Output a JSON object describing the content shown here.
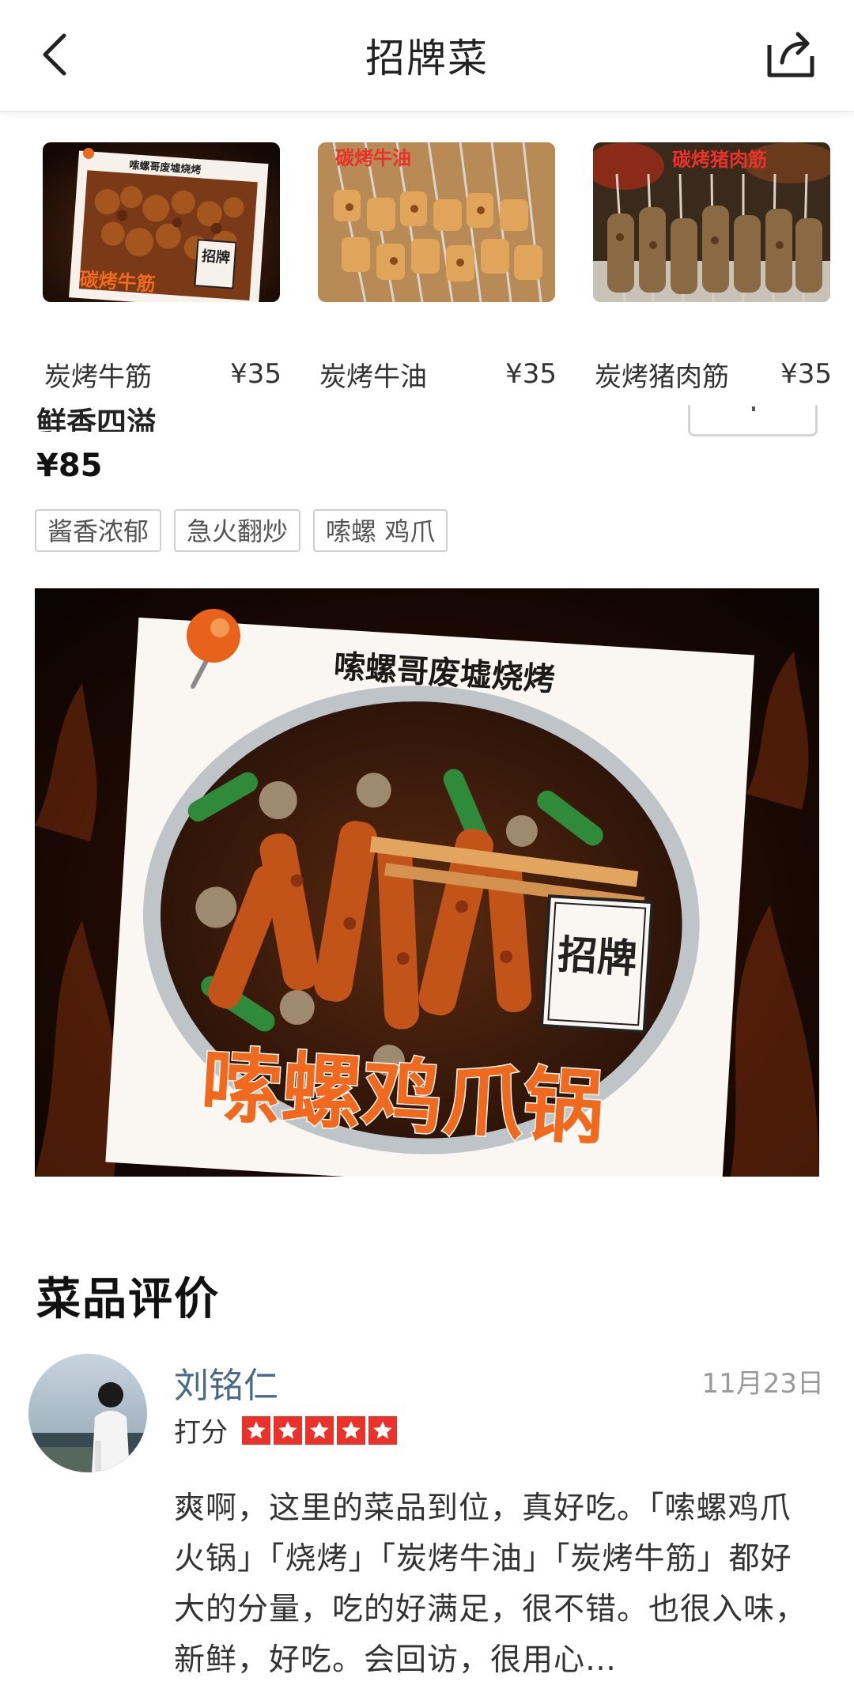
{
  "header": {
    "title": "招牌菜",
    "back_icon": "chevron-left-icon",
    "share_icon": "share-icon"
  },
  "carousel": {
    "items": [
      {
        "name": "炭烤牛筋",
        "price": "¥35",
        "image_caption": "碳烤牛筋"
      },
      {
        "name": "炭烤牛油",
        "price": "¥35",
        "image_caption": "碳烤牛油"
      },
      {
        "name": "炭烤猪肉筋",
        "price": "¥35",
        "image_caption": "碳烤猪肉筋"
      }
    ],
    "badge_text": "招牌",
    "shop_banner": "嗦螺哥废墟烧烤"
  },
  "dish": {
    "name_partial": "鲜香四溢",
    "price": "¥85",
    "tags": [
      "酱香浓郁",
      "急火翻炒",
      "嗦螺 鸡爪"
    ],
    "hero": {
      "banner": "嗦螺哥废墟烧烤",
      "badge": "招牌",
      "title": "嗦螺鸡爪锅"
    }
  },
  "reviews": {
    "section_title": "菜品评价",
    "items": [
      {
        "user": "刘铭仁",
        "date": "11月23日",
        "rating_label": "打分",
        "stars": 5,
        "text": "爽啊，这里的菜品到位，真好吃。「嗦螺鸡爪火锅」「烧烤」「炭烤牛油」「炭烤牛筋」都好大的分量，吃的好满足，很不错。也很入味，新鲜，好吃。会回访，很用心…"
      }
    ]
  },
  "colors": {
    "accent_red": "#e8322a",
    "username_blue": "#4a6a8a",
    "date_gray": "#999999",
    "tag_border": "#cfcfcf"
  }
}
